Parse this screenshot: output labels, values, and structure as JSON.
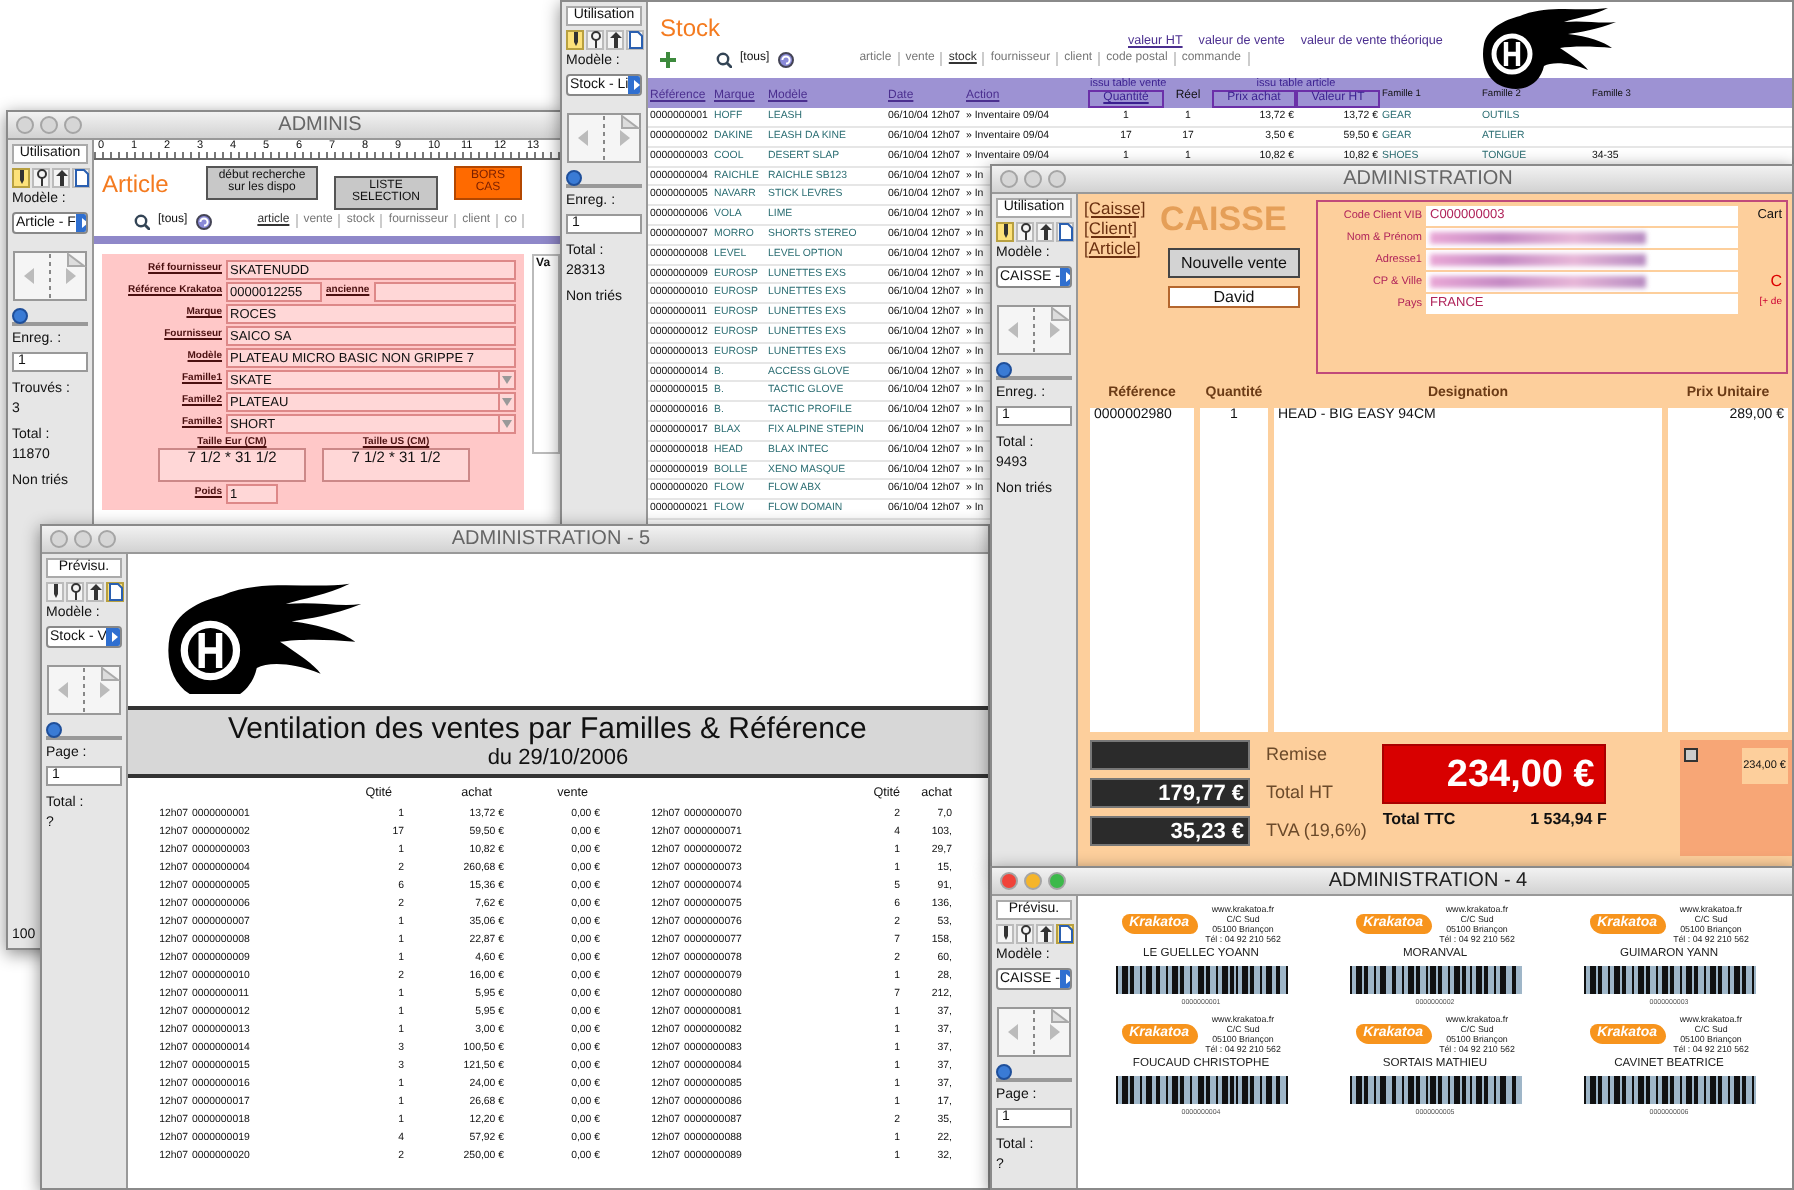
{
  "article_window": {
    "title": "ADMINIS",
    "active": false,
    "sidebar": {
      "mode": "Utilisation",
      "tools": [
        {
          "selected": true
        },
        {
          "selected": false
        },
        {
          "selected": false
        },
        {
          "selected": false
        }
      ],
      "model_label": "Modèle :",
      "model": "Article - F",
      "slider": {
        "level": 0
      },
      "fields": [
        {
          "kind": "input",
          "label": "Enreg. :",
          "value": "1"
        },
        {
          "kind": "stat",
          "label": "Trouvés :",
          "value": "3"
        },
        {
          "kind": "stat",
          "label": "Total :",
          "value": "11870"
        },
        {
          "kind": "note",
          "label": "Non triés"
        }
      ],
      "footer": "100"
    },
    "ruler": [
      "0",
      "1",
      "2",
      "3",
      "4",
      "5",
      "6",
      "7",
      "8",
      "9",
      "10",
      "11",
      "12",
      "13"
    ],
    "heading": "Article",
    "buttons": [
      {
        "kind": "gray",
        "label": "début recherche sur les dispo"
      },
      {
        "kind": "gray",
        "label": "LISTE SELECTION"
      },
      {
        "kind": "orange",
        "label": "BORS CAS"
      }
    ],
    "search": "[tous]",
    "nav": [
      {
        "label": "article",
        "selected": true
      },
      {
        "label": "vente",
        "selected": false
      },
      {
        "label": "stock",
        "selected": false
      },
      {
        "label": "fournisseur",
        "selected": false
      },
      {
        "label": "client",
        "selected": false
      },
      {
        "label": "co",
        "selected": false
      }
    ],
    "form": [
      {
        "kind": "text",
        "label": "Réf fournisseur",
        "value": "SKATENUDD"
      },
      {
        "kind": "split",
        "label": "Référence Krakatoa",
        "value": "0000012255",
        "extra_label": "ancienne"
      },
      {
        "kind": "text",
        "label": "Marque",
        "value": "ROCES"
      },
      {
        "kind": "text",
        "label": "Fournisseur",
        "value": "SAICO SA"
      },
      {
        "kind": "text",
        "label": "Modèle",
        "value": "PLATEAU MICRO BASIC NON GRIPPE 7"
      },
      {
        "kind": "select",
        "label": "Famille1",
        "value": "SKATE"
      },
      {
        "kind": "select",
        "label": "Famille2",
        "value": "PLATEAU"
      },
      {
        "kind": "select",
        "label": "Famille3",
        "value": "SHORT"
      },
      {
        "kind": "sizes",
        "sizes": [
          {
            "label": "Taille Eur (CM)",
            "value": "7 1/2 * 31 1/2"
          },
          {
            "label": "Taille US (CM)",
            "value": "7 1/2 * 31 1/2"
          }
        ]
      },
      {
        "kind": "short",
        "label": "Poids",
        "value": "1"
      }
    ],
    "side_column": "Va"
  },
  "stock_window": {
    "sidebar": {
      "mode": "Utilisation",
      "tools": [
        {
          "selected": true
        },
        {
          "selected": false
        },
        {
          "selected": false
        },
        {
          "selected": false
        }
      ],
      "model_label": "Modèle :",
      "model": "Stock - Li",
      "slider": {
        "level": 0
      },
      "fields": [
        {
          "kind": "input",
          "label": "Enreg. :",
          "value": "1"
        },
        {
          "kind": "stat",
          "label": "Total :",
          "value": "28313"
        },
        {
          "kind": "note",
          "label": "Non triés"
        }
      ]
    },
    "heading": "Stock",
    "value_links": [
      {
        "label": "valeur HT",
        "selected": true
      },
      {
        "label": "valeur de vente",
        "selected": false
      },
      {
        "label": "valeur de vente théorique",
        "selected": false
      }
    ],
    "search": "[tous]",
    "nav": [
      {
        "label": "article",
        "selected": false
      },
      {
        "label": "vente",
        "selected": false
      },
      {
        "label": "stock",
        "selected": true
      },
      {
        "label": "fournisseur",
        "selected": false
      },
      {
        "label": "client",
        "selected": false
      },
      {
        "label": "code postal",
        "selected": false
      },
      {
        "label": "commande",
        "selected": false
      }
    ],
    "column_groups": [
      "issu table vente",
      "issu table article"
    ],
    "columns": [
      {
        "label": "Référence",
        "kind": "link",
        "boxed": false
      },
      {
        "label": "Marque",
        "kind": "link",
        "boxed": false
      },
      {
        "label": "Modèle",
        "kind": "link",
        "boxed": false
      },
      {
        "label": "Date",
        "kind": "link",
        "boxed": false
      },
      {
        "label": "Action",
        "kind": "link",
        "boxed": false
      },
      {
        "label": "Quantité",
        "kind": "link",
        "boxed": true
      },
      {
        "label": "Réel",
        "kind": "plain",
        "boxed": false
      },
      {
        "label": "Prix achat",
        "kind": "plain",
        "boxed": true
      },
      {
        "label": "Valeur HT",
        "kind": "plain",
        "boxed": true
      },
      {
        "label": "Famille 1",
        "kind": "small",
        "boxed": false
      },
      {
        "label": "Famille 2",
        "kind": "small",
        "boxed": false
      },
      {
        "label": "Famille 3",
        "kind": "small",
        "boxed": false
      }
    ],
    "rows": [
      [
        "0000000001",
        "HOFF",
        "LEASH",
        "06/10/04 12h07",
        "» Inventaire 09/04",
        "1",
        "1",
        "13,72 €",
        "13,72 €",
        "GEAR",
        "OUTILS"
      ],
      [
        "0000000002",
        "DAKINE",
        "LEASH DA KINE",
        "06/10/04 12h07",
        "» Inventaire 09/04",
        "17",
        "17",
        "3,50 €",
        "59,50 €",
        "GEAR",
        "ATELIER"
      ],
      [
        "0000000003",
        "COOL",
        "DESERT SLAP",
        "06/10/04 12h07",
        "» Inventaire 09/04",
        "1",
        "1",
        "10,82 €",
        "10,82 €",
        "SHOES",
        "TONGUE",
        "34-35"
      ],
      [
        "0000000004",
        "RAICHLE",
        "RAICHLE SB123",
        "06/10/04 12h07",
        "» In"
      ],
      [
        "0000000005",
        "NAVARR",
        "STICK LEVRES",
        "06/10/04 12h07",
        "» In"
      ],
      [
        "0000000006",
        "VOLA",
        "LIME",
        "06/10/04 12h07",
        "» In"
      ],
      [
        "0000000007",
        "MORRO",
        "SHORTS STEREO",
        "06/10/04 12h07",
        "» In"
      ],
      [
        "0000000008",
        "LEVEL",
        "LEVEL OPTION",
        "06/10/04 12h07",
        "» In"
      ],
      [
        "0000000009",
        "EUROSP",
        "LUNETTES EXS",
        "06/10/04 12h07",
        "» In"
      ],
      [
        "0000000010",
        "EUROSP",
        "LUNETTES EXS",
        "06/10/04 12h07",
        "» In"
      ],
      [
        "0000000011",
        "EUROSP",
        "LUNETTES EXS",
        "06/10/04 12h07",
        "» In"
      ],
      [
        "0000000012",
        "EUROSP",
        "LUNETTES EXS",
        "06/10/04 12h07",
        "» In"
      ],
      [
        "0000000013",
        "EUROSP",
        "LUNETTES EXS",
        "06/10/04 12h07",
        "» In"
      ],
      [
        "0000000014",
        "B.",
        "ACCESS GLOVE",
        "06/10/04 12h07",
        "» In"
      ],
      [
        "0000000015",
        "B.",
        "TACTIC GLOVE",
        "06/10/04 12h07",
        "» In"
      ],
      [
        "0000000016",
        "B.",
        "TACTIC PROFILE",
        "06/10/04 12h07",
        "» In"
      ],
      [
        "0000000017",
        "BLAX",
        "FIX ALPINE STEPIN",
        "06/10/04 12h07",
        "» In"
      ],
      [
        "0000000018",
        "HEAD",
        "BLAX INTEC",
        "06/10/04 12h07",
        "» In"
      ],
      [
        "0000000019",
        "BOLLE",
        "XENO MASQUE",
        "06/10/04 12h07",
        "» In"
      ],
      [
        "0000000020",
        "FLOW",
        "FLOW ABX",
        "06/10/04 12h07",
        "» In"
      ],
      [
        "0000000021",
        "FLOW",
        "FLOW DOMAIN",
        "06/10/04 12h07",
        "» In"
      ]
    ]
  },
  "report_window": {
    "title": "ADMINISTRATION - 5",
    "active": false,
    "sidebar": {
      "mode": "Prévisu.",
      "tools": [
        {
          "selected": false
        },
        {
          "selected": false
        },
        {
          "selected": false
        },
        {
          "selected": true
        }
      ],
      "model_label": "Modèle :",
      "model": "Stock - V",
      "slider": {
        "level": 0
      },
      "fields": [
        {
          "kind": "input",
          "label": "Page :",
          "value": "1"
        },
        {
          "kind": "stat",
          "label": "Total :",
          "value": "?"
        }
      ]
    },
    "title_line": "Ventilation des ventes par Familles & Référence",
    "subtitle": "du 29/10/2006",
    "left_columns": [
      "Qtité",
      "achat",
      "vente"
    ],
    "right_columns": [
      "Qtité",
      "achat"
    ],
    "left_rows": [
      [
        "12h07",
        "0000000001",
        "1",
        "13,72 €",
        "0,00 €"
      ],
      [
        "12h07",
        "0000000002",
        "17",
        "59,50 €",
        "0,00 €"
      ],
      [
        "12h07",
        "0000000003",
        "1",
        "10,82 €",
        "0,00 €"
      ],
      [
        "12h07",
        "0000000004",
        "2",
        "260,68 €",
        "0,00 €"
      ],
      [
        "12h07",
        "0000000005",
        "6",
        "15,36 €",
        "0,00 €"
      ],
      [
        "12h07",
        "0000000006",
        "2",
        "7,62 €",
        "0,00 €"
      ],
      [
        "12h07",
        "0000000007",
        "1",
        "35,06 €",
        "0,00 €"
      ],
      [
        "12h07",
        "0000000008",
        "1",
        "22,87 €",
        "0,00 €"
      ],
      [
        "12h07",
        "0000000009",
        "1",
        "4,60 €",
        "0,00 €"
      ],
      [
        "12h07",
        "0000000010",
        "2",
        "16,00 €",
        "0,00 €"
      ],
      [
        "12h07",
        "0000000011",
        "1",
        "5,95 €",
        "0,00 €"
      ],
      [
        "12h07",
        "0000000012",
        "1",
        "5,95 €",
        "0,00 €"
      ],
      [
        "12h07",
        "0000000013",
        "1",
        "3,00 €",
        "0,00 €"
      ],
      [
        "12h07",
        "0000000014",
        "3",
        "100,50 €",
        "0,00 €"
      ],
      [
        "12h07",
        "0000000015",
        "3",
        "121,50 €",
        "0,00 €"
      ],
      [
        "12h07",
        "0000000016",
        "1",
        "24,00 €",
        "0,00 €"
      ],
      [
        "12h07",
        "0000000017",
        "1",
        "26,68 €",
        "0,00 €"
      ],
      [
        "12h07",
        "0000000018",
        "1",
        "12,20 €",
        "0,00 €"
      ],
      [
        "12h07",
        "0000000019",
        "4",
        "57,92 €",
        "0,00 €"
      ],
      [
        "12h07",
        "0000000020",
        "2",
        "250,00 €",
        "0,00 €"
      ]
    ],
    "right_rows": [
      [
        "12h07",
        "0000000070",
        "2",
        "7,0"
      ],
      [
        "12h07",
        "0000000071",
        "4",
        "103,"
      ],
      [
        "12h07",
        "0000000072",
        "1",
        "29,7"
      ],
      [
        "12h07",
        "0000000073",
        "1",
        "15,"
      ],
      [
        "12h07",
        "0000000074",
        "5",
        "91,"
      ],
      [
        "12h07",
        "0000000075",
        "6",
        "136,"
      ],
      [
        "12h07",
        "0000000076",
        "2",
        "53,"
      ],
      [
        "12h07",
        "0000000077",
        "7",
        "158,"
      ],
      [
        "12h07",
        "0000000078",
        "2",
        "60,"
      ],
      [
        "12h07",
        "0000000079",
        "1",
        "28,"
      ],
      [
        "12h07",
        "0000000080",
        "7",
        "212,"
      ],
      [
        "12h07",
        "0000000081",
        "1",
        "37,"
      ],
      [
        "12h07",
        "0000000082",
        "1",
        "37,"
      ],
      [
        "12h07",
        "0000000083",
        "1",
        "37,"
      ],
      [
        "12h07",
        "0000000084",
        "1",
        "37,"
      ],
      [
        "12h07",
        "0000000085",
        "1",
        "37,"
      ],
      [
        "12h07",
        "0000000086",
        "1",
        "17,"
      ],
      [
        "12h07",
        "0000000087",
        "2",
        "35,"
      ],
      [
        "12h07",
        "0000000088",
        "1",
        "22,"
      ],
      [
        "12h07",
        "0000000089",
        "1",
        "32,"
      ]
    ]
  },
  "caisse_window": {
    "title": "ADMINISTRATION",
    "active": false,
    "sidebar": {
      "mode": "Utilisation",
      "tools": [
        {
          "selected": true
        },
        {
          "selected": false
        },
        {
          "selected": false
        },
        {
          "selected": false
        }
      ],
      "model_label": "Modèle :",
      "model": "CAISSE -",
      "slider": {
        "level": 0
      },
      "fields": [
        {
          "kind": "input",
          "label": "Enreg. :",
          "value": "1"
        },
        {
          "kind": "stat",
          "label": "Total :",
          "value": "9493"
        },
        {
          "kind": "note",
          "label": "Non triés"
        }
      ]
    },
    "links": [
      "[Caisse]",
      "[Client]",
      "[Article]"
    ],
    "heading": "CAISSE",
    "new_sale": "Nouvelle vente",
    "seller": "David",
    "client": [
      {
        "label": "Code Client VIB",
        "value": "C000000003",
        "blurred": false
      },
      {
        "label": "Nom & Prénom",
        "blurred": true
      },
      {
        "label": "Adresse1",
        "blurred": true
      },
      {
        "label": "CP & Ville",
        "blurred": true
      },
      {
        "label": "Pays",
        "value": "FRANCE",
        "blurred": false
      }
    ],
    "card_label": "Cart",
    "side_mark": "C",
    "more_link": "[+ de",
    "columns": [
      "Référence",
      "Quantité",
      "Designation",
      "Prix Unitaire"
    ],
    "lines": [
      [
        "0000002980",
        "1",
        "HEAD - BIG EASY 94CM",
        "289,00 €"
      ]
    ],
    "totals": [
      {
        "label": "Remise"
      },
      {
        "label": "Total HT",
        "value": "179,77 €"
      },
      {
        "label": "TVA (19,6%)",
        "value": "35,23 €"
      }
    ],
    "ttc": {
      "amount": "234,00 €",
      "label": "Total TTC",
      "francs": "1 534,94 F"
    },
    "side_total": "234,00 €"
  },
  "labels_window": {
    "title": "ADMINISTRATION - 4",
    "active": true,
    "sidebar": {
      "mode": "Prévisu.",
      "tools": [
        {
          "selected": false
        },
        {
          "selected": false
        },
        {
          "selected": false
        },
        {
          "selected": true
        }
      ],
      "model_label": "Modèle :",
      "model": "CAISSE -",
      "slider": {
        "level": 0
      },
      "fields": [
        {
          "kind": "input",
          "label": "Page :",
          "value": "1"
        },
        {
          "kind": "stat",
          "label": "Total :",
          "value": "?"
        }
      ]
    },
    "cards": [
      {
        "logo": "Krakatoa",
        "address": [
          "www.krakatoa.fr",
          "C/C Sud",
          "05100 Briançon",
          "Tél : 04 92 210 562"
        ],
        "name": "LE GUELLEC YOANN",
        "code": "0000000001"
      },
      {
        "logo": "Krakatoa",
        "address": [
          "www.krakatoa.fr",
          "C/C Sud",
          "05100 Briançon",
          "Tél : 04 92 210 562"
        ],
        "name": "MORANVAL",
        "code": "0000000002"
      },
      {
        "logo": "Krakatoa",
        "address": [
          "www.krakatoa.fr",
          "C/C Sud",
          "05100 Briançon",
          "Tél : 04 92 210 562"
        ],
        "name": "GUIMARON YANN",
        "code": "0000000003"
      },
      {
        "logo": "Krakatoa",
        "address": [
          "www.krakatoa.fr",
          "C/C Sud",
          "05100 Briançon",
          "Tél : 04 92 210 562"
        ],
        "name": "FOUCAUD CHRISTOPHE",
        "code": "0000000004"
      },
      {
        "logo": "Krakatoa",
        "address": [
          "www.krakatoa.fr",
          "C/C Sud",
          "05100 Briançon",
          "Tél : 04 92 210 562"
        ],
        "name": "SORTAIS MATHIEU",
        "code": "0000000005"
      },
      {
        "logo": "Krakatoa",
        "address": [
          "www.krakatoa.fr",
          "C/C Sud",
          "05100 Briançon",
          "Tél : 04 92 210 562"
        ],
        "name": "CAVINET BEATRICE",
        "code": "0000000006"
      }
    ]
  }
}
